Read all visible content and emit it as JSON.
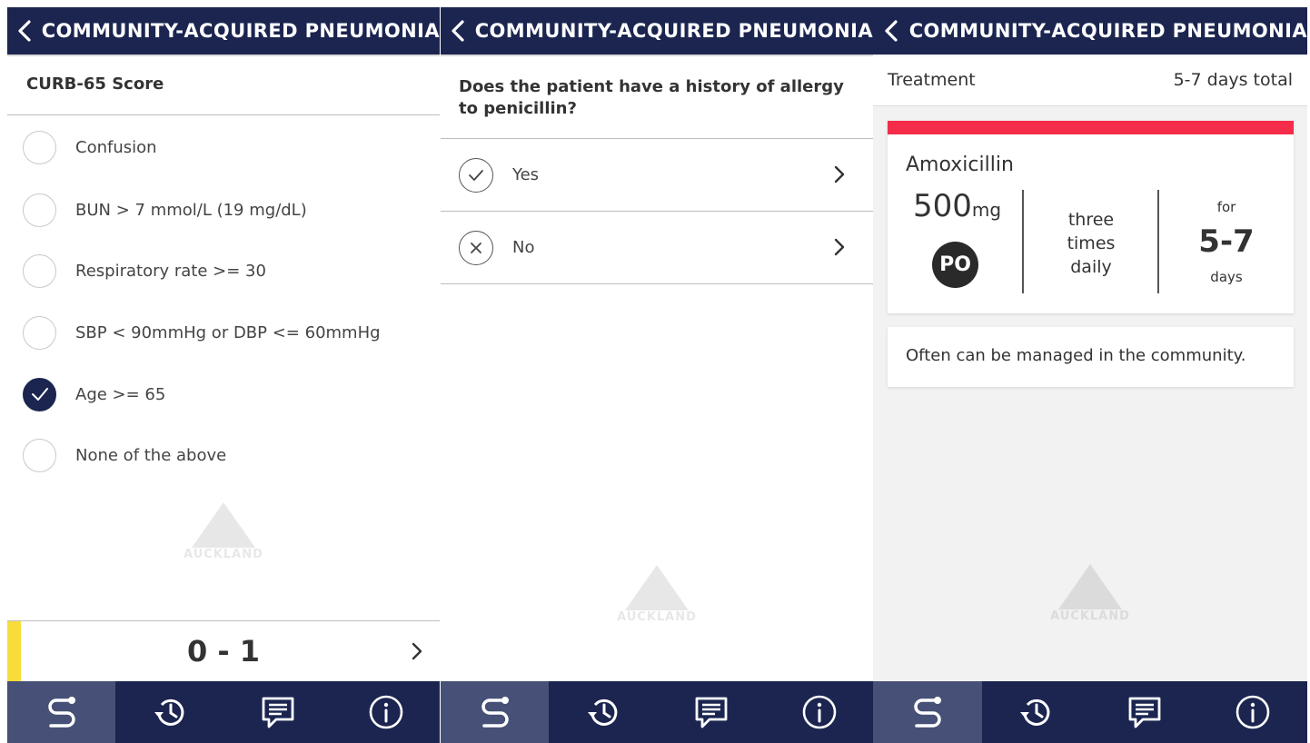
{
  "colors": {
    "header_bg": "#1b2550",
    "tab_active_bg": "#475076",
    "score_accent": "#f8dd3a",
    "drug_accent": "#f52c4a"
  },
  "panel1": {
    "header_title": "COMMUNITY-ACQUIRED PNEUMONIA",
    "section_title": "CURB-65 Score",
    "options": [
      {
        "label": "Confusion",
        "checked": false
      },
      {
        "label": "BUN > 7 mmol/L (19 mg/dL)",
        "checked": false
      },
      {
        "label": "Respiratory rate >= 30",
        "checked": false
      },
      {
        "label": "SBP < 90mmHg or DBP <= 60mmHg",
        "checked": false
      },
      {
        "label": "Age >= 65",
        "checked": true
      },
      {
        "label": "None of the above",
        "checked": false
      }
    ],
    "score": "0 - 1",
    "watermark": "AUCKLAND"
  },
  "panel2": {
    "header_title": "COMMUNITY-ACQUIRED PNEUMONIA",
    "question": "Does the patient have a history of allergy to penicillin?",
    "answers": [
      {
        "label": "Yes",
        "icon": "check-icon"
      },
      {
        "label": "No",
        "icon": "x-icon"
      }
    ],
    "watermark": "AUCKLAND"
  },
  "panel3": {
    "header_title": "COMMUNITY-ACQUIRED PNEUMONIA",
    "treatment_label": "Treatment",
    "treatment_total": "5-7 days total",
    "drug": {
      "name": "Amoxicillin",
      "dose": "500",
      "unit": "mg",
      "route": "PO",
      "frequency_lines": [
        "three",
        "times",
        "daily"
      ],
      "duration_prefix": "for",
      "duration": "5-7",
      "duration_unit": "days"
    },
    "note": "Often can be managed in the community.",
    "watermark": "AUCKLAND"
  },
  "tabbar": [
    {
      "icon": "pathway-icon",
      "active": true
    },
    {
      "icon": "history-icon",
      "active": false
    },
    {
      "icon": "feedback-icon",
      "active": false
    },
    {
      "icon": "info-icon",
      "active": false
    }
  ]
}
